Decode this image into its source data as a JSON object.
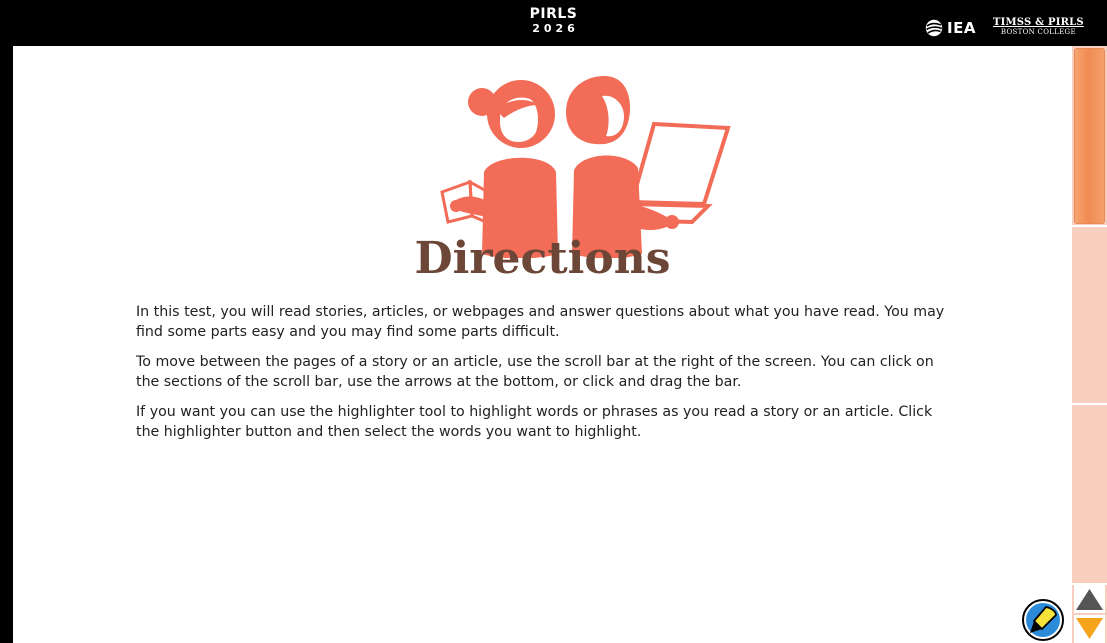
{
  "header": {
    "title": "PIRLS",
    "year": "2026",
    "iea_label": "IEA",
    "timss_pirls_line1": "TIMSS & PIRLS",
    "timss_pirls_line2": "BOSTON COLLEGE"
  },
  "main": {
    "heading": "Directions",
    "paragraphs": [
      "In this test, you will read stories, articles, or webpages and answer questions about what you have read. You may find some parts easy and you may find some parts difficult.",
      "To move between the pages of a story or an article, use the scroll bar at the right of the screen. You can click on the sections of the scroll bar, use the arrows at the bottom, or click and drag the bar.",
      "If you want you can use the highlighter tool to highlight words or phrases as you read a story or an article. Click the highlighter button and then select the words you want to highlight."
    ]
  },
  "scrollbar": {
    "sections": 3,
    "current_section": 1
  },
  "tools": {
    "highlighter_icon": "highlighter-icon",
    "arrow_up_icon": "arrow-up-icon",
    "arrow_down_icon": "arrow-down-icon"
  },
  "colors": {
    "accent": "#f26c57",
    "heading": "#6c4636",
    "scroll_track": "#f8cfbf",
    "scroll_thumb": "#f08b52",
    "arrow_up": "#555555",
    "arrow_down": "#f4a31a"
  }
}
